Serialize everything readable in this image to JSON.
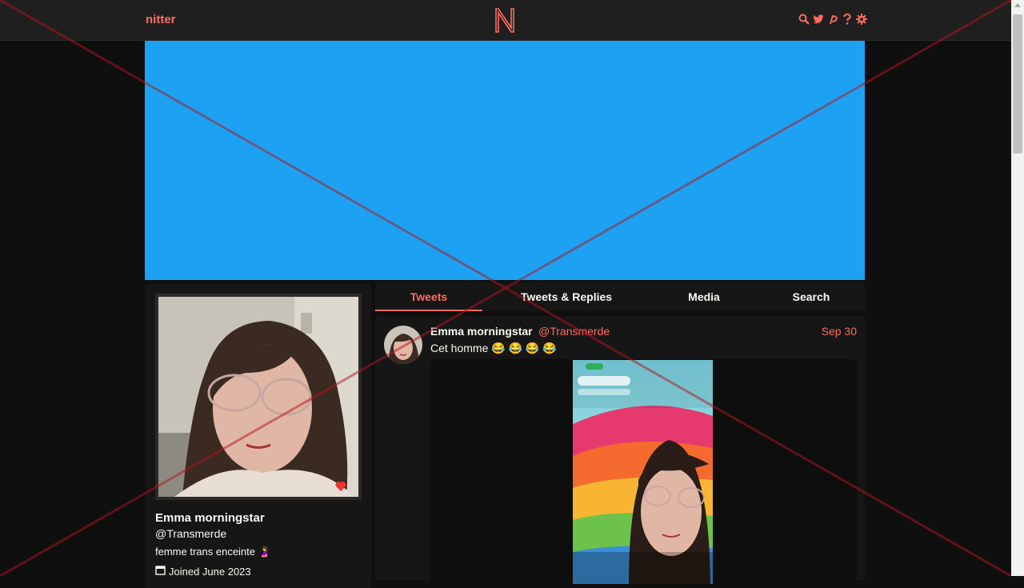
{
  "navbar": {
    "brand": "nitter",
    "logo_letter": "N",
    "icons": [
      "search-icon",
      "twitter-icon",
      "rss-icon",
      "help-icon",
      "settings-icon"
    ]
  },
  "banner": {
    "color": "#1da1f2"
  },
  "profile": {
    "name": "Emma morningstar",
    "handle": "@Transmerde",
    "bio": "femme trans enceinte 🤰",
    "joined": "Joined June 2023"
  },
  "tabs": [
    {
      "label": "Tweets",
      "active": true
    },
    {
      "label": "Tweets & Replies",
      "active": false
    },
    {
      "label": "Media",
      "active": false
    },
    {
      "label": "Search",
      "active": false
    }
  ],
  "tweet": {
    "author": "Emma morningstar",
    "handle": "@Transmerde",
    "date": "Sep 30",
    "text": "Cet homme 😂 😂 😂 😂"
  },
  "colors": {
    "accent": "#ff6c60",
    "background": "#0f0f0f",
    "panel": "#161616",
    "overlay": "#b4141e"
  }
}
